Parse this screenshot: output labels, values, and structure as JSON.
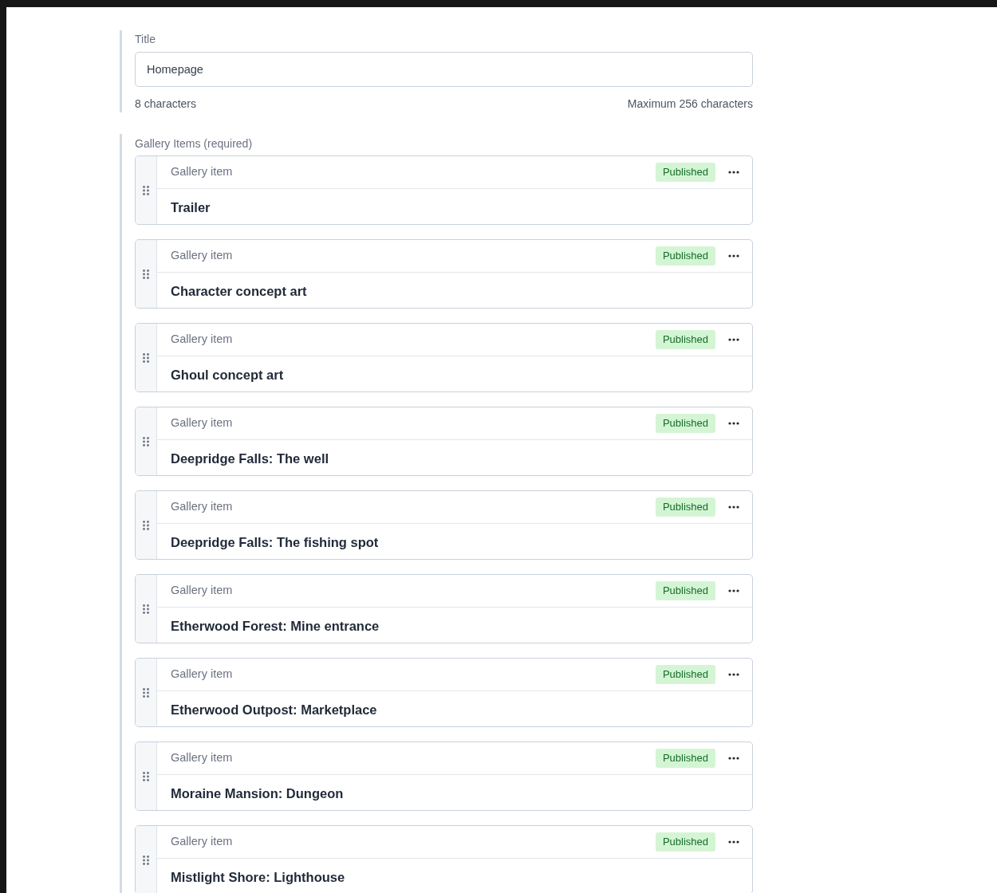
{
  "title_field": {
    "label": "Title",
    "value": "Homepage",
    "count": "8 characters",
    "limit": "Maximum 256 characters"
  },
  "gallery": {
    "label": "Gallery Items (required)",
    "items": [
      {
        "type": "Gallery item",
        "status": "Published",
        "title": "Trailer"
      },
      {
        "type": "Gallery item",
        "status": "Published",
        "title": "Character concept art"
      },
      {
        "type": "Gallery item",
        "status": "Published",
        "title": "Ghoul concept art"
      },
      {
        "type": "Gallery item",
        "status": "Published",
        "title": "Deepridge Falls: The well"
      },
      {
        "type": "Gallery item",
        "status": "Published",
        "title": "Deepridge Falls: The fishing spot"
      },
      {
        "type": "Gallery item",
        "status": "Published",
        "title": "Etherwood Forest: Mine entrance"
      },
      {
        "type": "Gallery item",
        "status": "Published",
        "title": "Etherwood Outpost: Marketplace"
      },
      {
        "type": "Gallery item",
        "status": "Published",
        "title": "Moraine Mansion: Dungeon"
      },
      {
        "type": "Gallery item",
        "status": "Published",
        "title": "Mistlight Shore: Lighthouse"
      }
    ]
  }
}
